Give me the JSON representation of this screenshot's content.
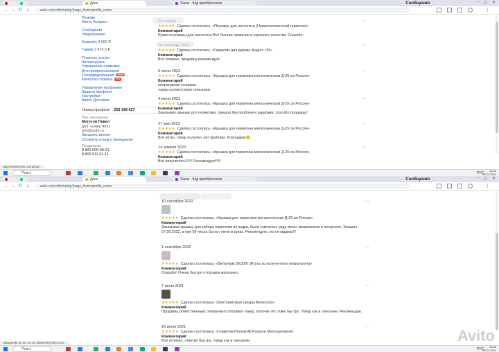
{
  "colors": {
    "accent": "#1e5bc6",
    "star": "#f5a623",
    "badge": "#e4403a"
  },
  "top": {
    "tabs": [
      {
        "label": "",
        "fav": "#c0392b"
      },
      {
        "label": "",
        "fav": "#2ecc71"
      },
      {
        "label": "Диск",
        "fav": "#f1c40f"
      },
      {
        "label": "Заказ - Код приобретения",
        "fav": "#8e44ad"
      }
    ],
    "url": "avito.ru/profile/rating?page_from=profile_menu",
    "sidebar": {
      "links_a": [
        "Резюме",
        "Авито Аукцион"
      ],
      "links_b": [
        "Сообщения",
        "Уведомления"
      ],
      "wallet_label": "Кошелёк",
      "wallet_value": "4 000 ₽",
      "tariff_label": "Тариф",
      "tariff_value": "2 476.5 ₽",
      "links_c": [
        "Платные услуги",
        "Автозагрузка",
        "Управление ставками"
      ],
      "pro_label": "Для профессионалов",
      "special_label": "Спецпредложения",
      "special_badge": "новое",
      "quality_label": "Качество сервиса",
      "quality_badge": "new",
      "links_d": [
        "Управление профилем",
        "Защита профиля",
        "Настройки",
        "Авито Доставка"
      ],
      "profile_number_label": "Номер профиля",
      "profile_number_value": "203 198 627",
      "manager_label": "Ваш менеджер",
      "manager_name": "Могутов Павел",
      "manager_ext": "доб. номер 4691",
      "manager_email": "pmi@avito.ru",
      "manager_links": [
        "Заказать звонок",
        "Оставить отзыв о менеджере"
      ],
      "support_label": "Поддержка",
      "phone1": "8 800 600-00-01",
      "phone2": "8 800 511-01-11"
    },
    "reviews": [
      {
        "date": "23 января",
        "deal": "Сделка состоялась: «Плунжер для пистолета (Нерасположенный герметик)»",
        "label": "Комментарий",
        "comment": "Купил плунжеры для пистолета Всё быстро привезли и хорошего качества. Спасибо."
      },
      {
        "date": "18 сентября 2023",
        "deal": "Сделка состоялась: «Герметик для дерева Акцент 136»",
        "label": "Комментарий",
        "comment": "Всё отлично, продавца рекомендую."
      },
      {
        "date": "9 июля 2023",
        "deal": "Сделка состоялась: «Крышка для герметика металлическая Д-29 см Россия»",
        "label": "Комментарий",
        "comment": "оперативная отправка\nтовар соответствует описанию"
      },
      {
        "date": "4 июня 2023",
        "deal": "Сделка состоялась: «Крышка для герметика металлическая Д-29 см Россия»",
        "label": "Комментарий",
        "comment": "Заказывал крышку для герметика, пришла без проблем и задержек. спасибо продавцу!"
      },
      {
        "date": "27 мая 2023",
        "deal": "Сделка состоялась: «Крышка для герметика металлическая Д-29 см Россия»",
        "label": "Комментарий",
        "comment": "Всё чётко, товар получил, нет проблем. Благодарю😊"
      },
      {
        "date": "14 апреля 2023",
        "deal": "Сделка состоялась: «Крышка для герметика металлическая Д-29 см Россия»",
        "label": "Комментарий",
        "comment": "Всё получилось!!!!!!! Рекомендую!!!!!!"
      }
    ],
    "status_url": "https://www.avito.ru/rating/...",
    "notification": "Сообщения",
    "taskbar": {
      "search": "Поиск",
      "lang": "РУС",
      "time": "10:31",
      "date": "26.01.2024"
    }
  },
  "bottom": {
    "tabs": [
      {
        "label": "",
        "fav": "#c0392b"
      },
      {
        "label": "",
        "fav": "#2ecc71"
      },
      {
        "label": "Диск",
        "fav": "#f1c40f"
      },
      {
        "label": "Заказ - Код приобретения",
        "fav": "#8e44ad"
      }
    ],
    "url": "avito.ru/profile/rating?page_from=profile_menu",
    "reviews": [
      {
        "date": "10 сентября 2022",
        "thumb": "#b9c4cf",
        "deal": "Сделка состоялась: «Крышка для герметика металлическая Д-29 см Россия»",
        "label": "Комментарий",
        "comment": "Заказывал крышку для забора герметика из ведра, были сомнения, ведь много мошенников в интернете. Заказал 07.09.2022, а уже 09 числа была у меня в руках. Рекомендую, это не кидалы!!!"
      },
      {
        "date": "1 сентября 2022",
        "thumb": "#cfb9c4",
        "deal": "Сделка состоялась: «Вилатерм 30,50/6 (Жгуты из вспененного полиэтилен)»",
        "label": "Комментарий",
        "comment": "Спасибо! Очень быстро отгрузили материал."
      },
      {
        "date": "7 июля 2021",
        "thumb": "#55504a",
        "deal": "Сделка состоялась: «Бентонитовые шнуры Bentocord»",
        "label": "Комментарий",
        "comment": "Продавец ответственный, оперативно отправил товар, получил его тоже быстро. Товар как в описании. Рекомендую."
      },
      {
        "date": "16 июля 2021",
        "thumb": "",
        "deal": "Сделка состоялась: «Герметик Penosil All Purpose Многоцелевой»",
        "label": "Комментарий",
        "comment": "Всё отлично, ответил быстро, товар как в описании."
      }
    ],
    "status_url": "Ожидание gc.kis.v2.scr.kaspersky-labs.com...",
    "notification": "Сообщения",
    "watermark": "Avito",
    "taskbar": {
      "search": "Поиск",
      "lang": "РУС",
      "time": "10:32",
      "date": "26.01.2024"
    }
  }
}
